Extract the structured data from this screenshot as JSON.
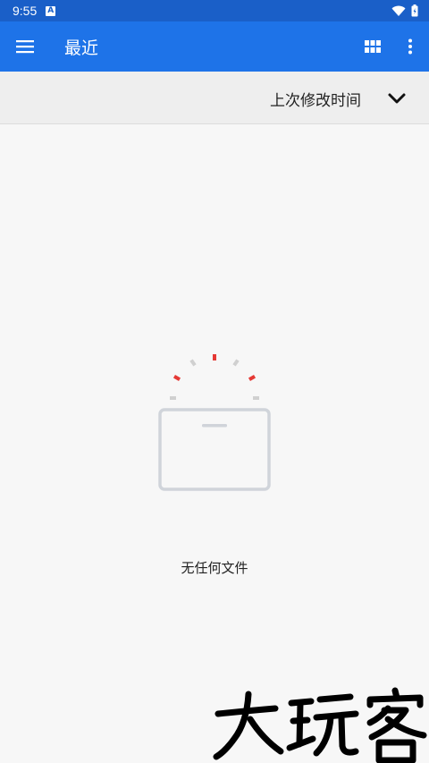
{
  "status_bar": {
    "time": "9:55",
    "notification_icon_letter": "A",
    "icons": [
      "app-notification-icon",
      "wifi-icon",
      "battery-icon"
    ]
  },
  "app_bar": {
    "title": "最近",
    "icons": [
      "hamburger-menu-icon",
      "grid-view-icon",
      "more-vert-icon"
    ],
    "color": "#1e73e8",
    "status_color": "#1a5fc8"
  },
  "sort_bar": {
    "label": "上次修改时间",
    "icon": "chevron-down-icon"
  },
  "empty_state": {
    "message": "无任何文件",
    "icon": "empty-folder-icon",
    "accent_color": "#e53935"
  },
  "watermark": {
    "text": "大玩客"
  }
}
